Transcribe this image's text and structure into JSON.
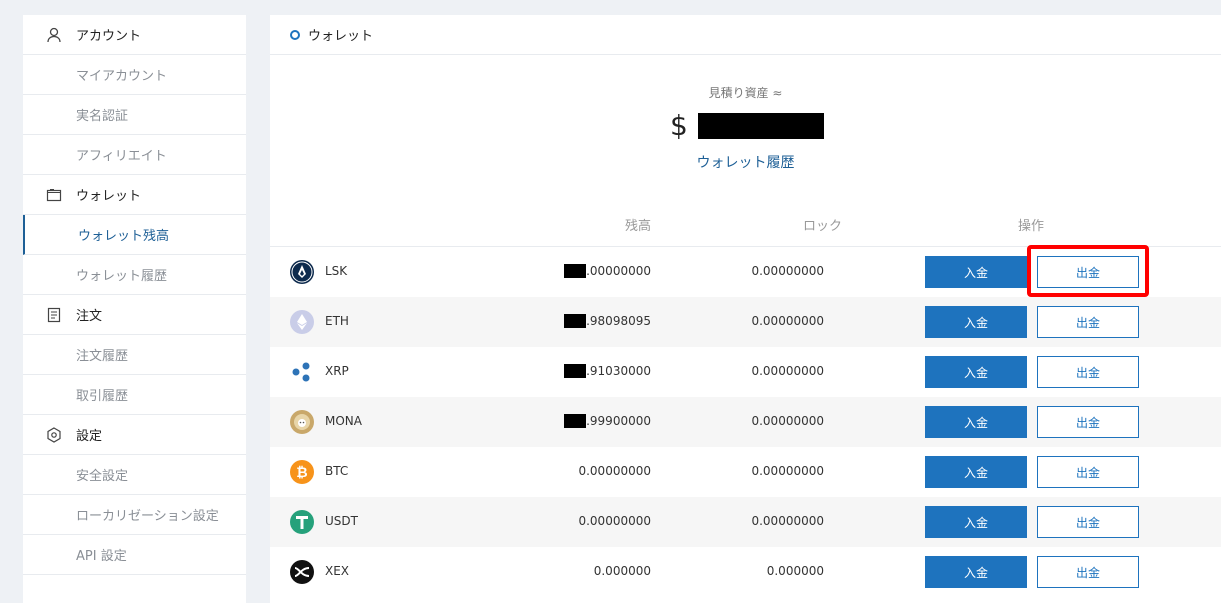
{
  "sidebar": {
    "items": [
      {
        "label": "アカウント",
        "icon": "user-icon"
      },
      {
        "label": "マイアカウント"
      },
      {
        "label": "実名認証"
      },
      {
        "label": "アフィリエイト"
      },
      {
        "label": "ウォレット",
        "icon": "wallet-icon"
      },
      {
        "label": "ウォレット残高"
      },
      {
        "label": "ウォレット履歴"
      },
      {
        "label": "注文",
        "icon": "document-icon"
      },
      {
        "label": "注文履歴"
      },
      {
        "label": "取引履歴"
      },
      {
        "label": "設定",
        "icon": "hexagon-settings-icon"
      },
      {
        "label": "安全設定"
      },
      {
        "label": "ローカリゼーション設定"
      },
      {
        "label": "API 設定"
      }
    ]
  },
  "header": {
    "title": "ウォレット"
  },
  "summary": {
    "estimate_label": "見積り資産 ≈",
    "currency_symbol": "$",
    "history_link": "ウォレット履歴"
  },
  "table": {
    "columns": {
      "balance": "残高",
      "lock": "ロック",
      "action": "操作"
    },
    "rows": [
      {
        "coin": "LSK",
        "balance": ".00000000",
        "lock": "0.00000000",
        "icon": "lsk-icon",
        "deposit": "入金",
        "withdraw": "出金"
      },
      {
        "coin": "ETH",
        "balance": ".98098095",
        "lock": "0.00000000",
        "icon": "eth-icon",
        "deposit": "入金",
        "withdraw": "出金"
      },
      {
        "coin": "XRP",
        "balance": ".91030000",
        "lock": "0.00000000",
        "icon": "xrp-icon",
        "deposit": "入金",
        "withdraw": "出金"
      },
      {
        "coin": "MONA",
        "balance": ".99900000",
        "lock": "0.00000000",
        "icon": "mona-icon",
        "deposit": "入金",
        "withdraw": "出金"
      },
      {
        "coin": "BTC",
        "balance": "0.00000000",
        "lock": "0.00000000",
        "icon": "btc-icon",
        "deposit": "入金",
        "withdraw": "出金"
      },
      {
        "coin": "USDT",
        "balance": "0.00000000",
        "lock": "0.00000000",
        "icon": "usdt-icon",
        "deposit": "入金",
        "withdraw": "出金"
      },
      {
        "coin": "XEX",
        "balance": "0.000000",
        "lock": "0.000000",
        "icon": "xex-icon",
        "deposit": "入金",
        "withdraw": "出金"
      }
    ]
  },
  "colors": {
    "accent": "#1e73be",
    "highlight": "#ff0000"
  }
}
